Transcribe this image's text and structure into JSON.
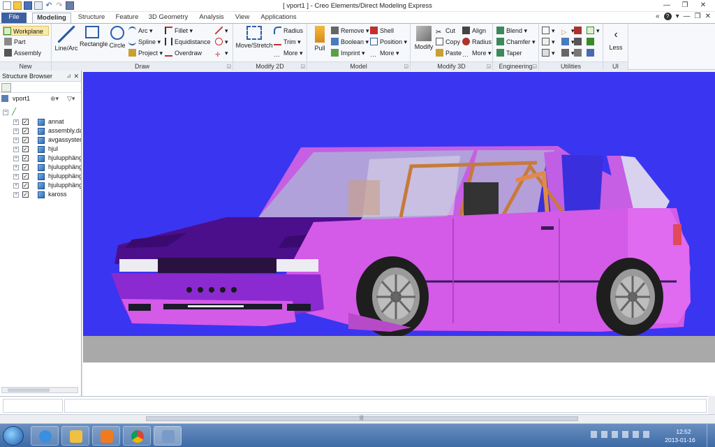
{
  "window": {
    "title": "[ vport1 ] - Creo Elements/Direct Modeling Express"
  },
  "tabs": [
    {
      "label": "File"
    },
    {
      "label": "Modeling"
    },
    {
      "label": "Structure"
    },
    {
      "label": "Feature"
    },
    {
      "label": "3D Geometry"
    },
    {
      "label": "Analysis"
    },
    {
      "label": "View"
    },
    {
      "label": "Applications"
    }
  ],
  "help": {
    "arrow": "«",
    "question": "?",
    "question_menu": "▾",
    "min": "—",
    "restore": "❐",
    "close": "✕"
  },
  "ribbon": {
    "new": {
      "label": "New",
      "workplane": "Workplane",
      "part": "Part",
      "assembly": "Assembly"
    },
    "draw": {
      "label": "Draw",
      "line_arc": "Line/Arc",
      "rectangle": "Rectangle",
      "circle": "Circle",
      "arc": "Arc",
      "spline": "Spline",
      "project": "Project",
      "fillet": "Fillet",
      "equidistance": "Equidistance",
      "overdraw": "Overdraw"
    },
    "modify2d": {
      "label": "Modify 2D",
      "move_stretch": "Move/Stretch",
      "radius": "Radius",
      "trim": "Trim",
      "more": "More"
    },
    "model": {
      "label": "Model",
      "pull": "Pull",
      "remove": "Remove",
      "boolean": "Boolean",
      "imprint": "Imprint",
      "shell": "Shell",
      "position": "Position",
      "more": "More"
    },
    "modify3d": {
      "label": "Modify 3D",
      "modify": "Modify",
      "cut": "Cut",
      "copy": "Copy",
      "paste": "Paste",
      "align": "Align",
      "radius": "Radius",
      "more": "More"
    },
    "engineering": {
      "label": "Engineering",
      "blend": "Blend",
      "chamfer": "Chamfer",
      "taper": "Taper"
    },
    "utilities": {
      "label": "Utilities"
    },
    "ui": {
      "label": "UI",
      "less": "Less"
    }
  },
  "structure_browser": {
    "title": "Structure Browser",
    "viewport": "vport1",
    "items": [
      {
        "label": "annat"
      },
      {
        "label": "assembly.da"
      },
      {
        "label": "avgassystem"
      },
      {
        "label": "hjul"
      },
      {
        "label": "hjulupphäng"
      },
      {
        "label": "hjulupphäng"
      },
      {
        "label": "hjulupphäng"
      },
      {
        "label": "hjulupphäng"
      },
      {
        "label": "kaross"
      }
    ]
  },
  "colors": {
    "viewport_bg": "#3a35f0",
    "ground": "#a9a9a9",
    "car_body": "#d45ae8",
    "car_hood": "#4c0f8c",
    "windshield": "#b8b0dc"
  },
  "taskbar": {
    "time": "12:52",
    "date": "2013-01-16"
  }
}
